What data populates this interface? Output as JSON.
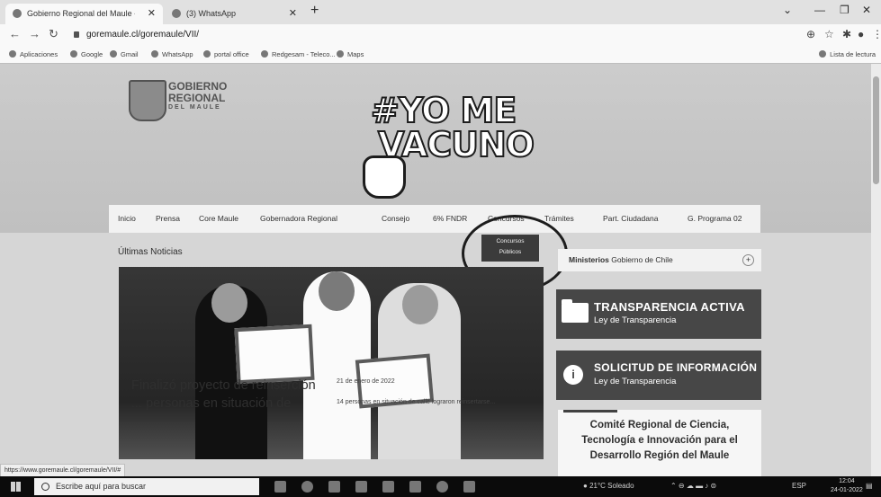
{
  "browser": {
    "tabs": [
      {
        "title": "Gobierno Regional del Maule - I",
        "active": true
      },
      {
        "title": "(3) WhatsApp",
        "active": false
      }
    ],
    "url": "goremaule.cl/goremaule/VII/",
    "bookmarks": [
      "Aplicaciones",
      "Google",
      "Gmail",
      "WhatsApp",
      "portal office",
      "Redgesam - Teleco...",
      "Maps"
    ],
    "reading_list": "Lista de lectura",
    "status_url": "https://www.goremaule.cl/goremaule/VII/#"
  },
  "site": {
    "logo": {
      "line1": "GOBIERNO",
      "line2": "REGIONAL",
      "line3": "DEL MAULE"
    },
    "campaign": {
      "line1": "#YO ME",
      "line2": "VACUNO"
    },
    "nav": [
      "Inicio",
      "Prensa",
      "Core Maule",
      "Gobernadora Regional",
      "Consejo",
      "6% FNDR",
      "Concursos",
      "Trámites",
      "Part. Ciudadana",
      "G. Programa 02"
    ],
    "dropdown": {
      "line1": "Concursos",
      "line2": "Públicos"
    },
    "news_section": "Últimas Noticias",
    "headline": "Finalizó proyecto de reinserción ... personas en situación de",
    "date": "21 de enero de 2022",
    "excerpt": "14 personas en situación de calle lograron reinsertarse...",
    "ministry": {
      "bold": "Ministerios",
      "rest": "Gobierno de Chile"
    },
    "cards": [
      {
        "title": "TRANSPARENCIA ACTIVA",
        "subtitle": "Ley de Transparencia"
      },
      {
        "title": "SOLICITUD DE INFORMACIÓN",
        "subtitle": "Ley de Transparencia"
      }
    ],
    "comite": "Comité Regional de Ciencia, Tecnología e Innovación para el Desarrollo Región del Maule"
  },
  "taskbar": {
    "search_placeholder": "Escribe aquí para buscar",
    "weather": "21°C Soleado",
    "lang": "ESP",
    "time": "12:04",
    "date": "24-01-2022"
  }
}
